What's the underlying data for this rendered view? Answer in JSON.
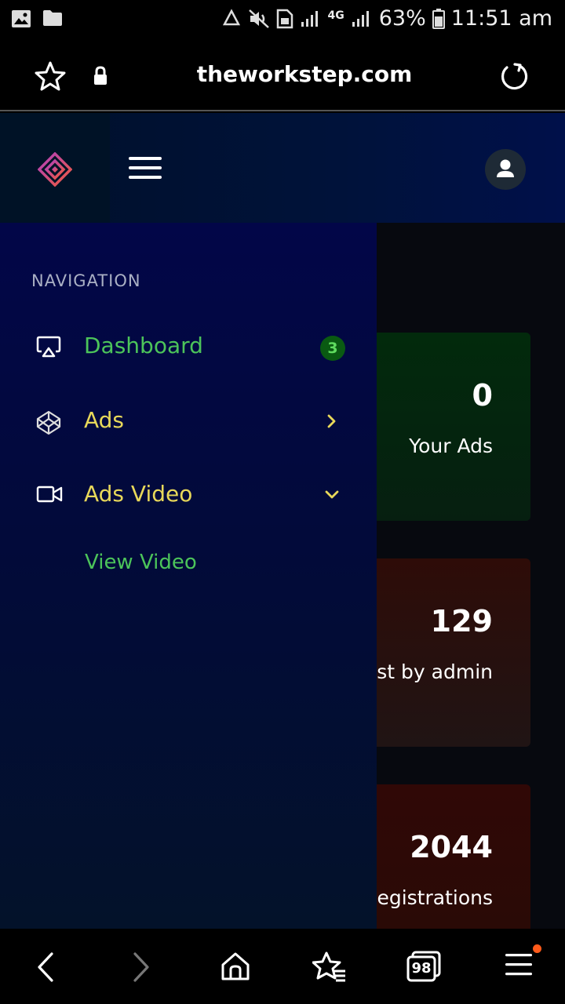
{
  "status_bar": {
    "network": "4G",
    "battery": "63%",
    "time": "11:51 am"
  },
  "browser": {
    "url": "theworkstep.com"
  },
  "colors": {
    "nav_active": "#4cc45a",
    "nav_item": "#e8d85a",
    "badge_bg": "#0a5a12"
  },
  "sidebar": {
    "heading": "NAVIGATION",
    "items": [
      {
        "label": "Dashboard",
        "icon": "airplay-icon",
        "badge": "3"
      },
      {
        "label": "Ads",
        "icon": "codepen-icon",
        "arrow": "chevron-right-icon"
      },
      {
        "label": "Ads Video",
        "icon": "video-icon",
        "arrow": "chevron-down-icon"
      }
    ],
    "subitems": [
      {
        "label": "View Video"
      }
    ]
  },
  "cards": [
    {
      "value": "0",
      "label": "Your Ads"
    },
    {
      "value": "129",
      "label": "ost by admin"
    },
    {
      "value": "2044",
      "label": "egistrations"
    }
  ],
  "bottom_bar": {
    "tab_count": "98"
  }
}
